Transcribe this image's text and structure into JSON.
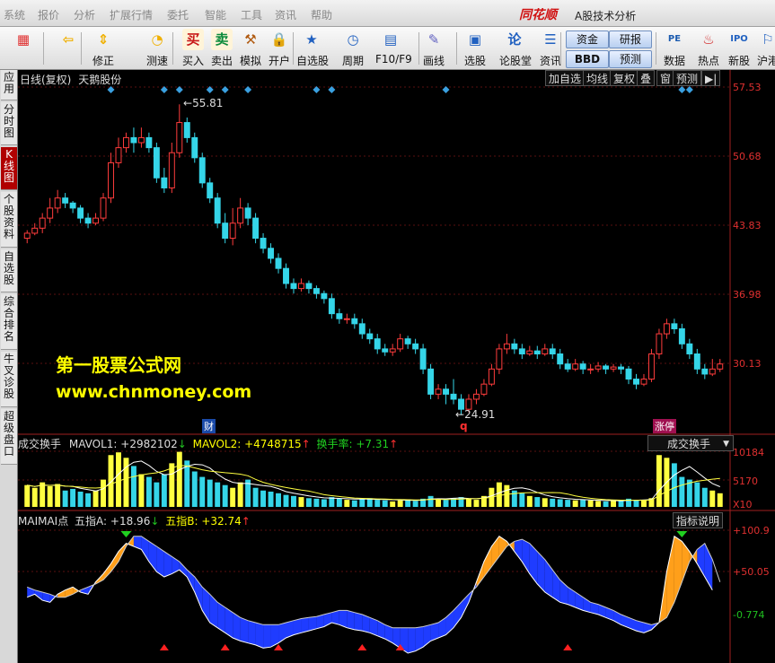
{
  "menu": [
    "系统",
    "报价",
    "分析",
    "扩展行情",
    "委托",
    "智能",
    "工具",
    "资讯",
    "帮助"
  ],
  "brand": "同花顺",
  "app_title": "A股技术分析",
  "toolbar": [
    {
      "label": "",
      "icon": "color-blocks-icon"
    },
    {
      "label": "",
      "icon": "back-arrow-icon"
    },
    {
      "label": "修正",
      "icon": "up-down-arrows-icon"
    },
    {
      "label": "测速",
      "icon": "speed-clock-icon"
    },
    {
      "label": "买入",
      "icon": "buy-icon",
      "glyph": "买"
    },
    {
      "label": "卖出",
      "icon": "sell-icon",
      "glyph": "卖"
    },
    {
      "label": "模拟",
      "icon": "hammer-icon"
    },
    {
      "label": "开户",
      "icon": "lock-icon"
    },
    {
      "label": "自选股",
      "icon": "star-list-icon"
    },
    {
      "label": "周期",
      "icon": "clock-cycle-icon"
    },
    {
      "label": "F10/F9",
      "icon": "f10-doc-icon"
    },
    {
      "label": "画线",
      "icon": "pencil-icon"
    },
    {
      "label": "选股",
      "icon": "stock-picker-icon"
    },
    {
      "label": "论股堂",
      "icon": "discussion-icon"
    },
    {
      "label": "资讯",
      "icon": "news-icon"
    },
    {
      "label": "资金",
      "icon": "funds-icon"
    },
    {
      "label": "BBD",
      "icon": "bbd-icon"
    },
    {
      "label": "研报",
      "icon": "research-icon"
    },
    {
      "label": "预测",
      "icon": "forecast-icon"
    },
    {
      "label": "数据",
      "icon": "pe-data-icon",
      "glyph": "PE"
    },
    {
      "label": "热点",
      "icon": "hot-spot-icon"
    },
    {
      "label": "新股",
      "icon": "ipo-icon",
      "glyph": "IPO"
    },
    {
      "label": "沪港",
      "icon": "hk-connect-icon"
    }
  ],
  "sidetabs": [
    {
      "label": "应用",
      "active": false
    },
    {
      "label": "分时图",
      "active": false
    },
    {
      "label": "K线图",
      "active": true
    },
    {
      "label": "个股资料",
      "active": false
    },
    {
      "label": "自选股",
      "active": false
    },
    {
      "label": "综合排名",
      "active": false
    },
    {
      "label": "牛叉诊股",
      "active": false
    },
    {
      "label": "超级盘口",
      "active": false
    }
  ],
  "chart_header": {
    "title": "日线(复权)",
    "stock": "天鹅股份",
    "buttons": [
      "加自选",
      "均线",
      "复权",
      "叠",
      "窗",
      "预测"
    ]
  },
  "price_axis": [
    "57.53",
    "50.68",
    "43.83",
    "36.98",
    "30.13"
  ],
  "annotations": {
    "high": "55.81",
    "low": "24.91",
    "marker_q": "q",
    "event_cai": "财",
    "event_zhang": "涨停"
  },
  "watermark": {
    "line1": "第一股票公式网",
    "line2": "www.chnmoney.com"
  },
  "volume_panel": {
    "name": "成交换手",
    "mavol1_label": "MAVOL1:",
    "mavol1_value": "+2982102",
    "mavol1_arrow": "↓",
    "mavol2_label": "MAVOL2:",
    "mavol2_value": "+4748715",
    "mavol2_arrow": "↑",
    "turnover_label": "换手率:",
    "turnover_value": "+7.31",
    "turnover_arrow": "↑",
    "selector": "成交换手",
    "axis": [
      "10184",
      "5170",
      "X10"
    ]
  },
  "indicator_panel": {
    "name": "MAIMAI点",
    "a_label": "五指A:",
    "a_value": "+18.96",
    "a_arrow": "↓",
    "b_label": "五指B:",
    "b_value": "+32.74",
    "b_arrow": "↑",
    "button": "指标说明",
    "axis": [
      "+100.9",
      "+50.05",
      "-0.774"
    ]
  },
  "chart_data": {
    "type": "candlestick",
    "series": [
      {
        "name": "price",
        "candles": [
          [
            42.5,
            43.0,
            42.0,
            43.3
          ],
          [
            43.0,
            43.5,
            42.8,
            44.0
          ],
          [
            43.5,
            44.5,
            43.0,
            45.0
          ],
          [
            44.5,
            45.5,
            44.0,
            46.5
          ],
          [
            45.5,
            46.5,
            45.0,
            47.3
          ],
          [
            46.5,
            46.0,
            45.5,
            47.0
          ],
          [
            46.0,
            45.5,
            45.0,
            46.2
          ],
          [
            45.5,
            44.5,
            44.0,
            45.8
          ],
          [
            44.5,
            44.0,
            43.5,
            45.0
          ],
          [
            44.0,
            44.5,
            43.8,
            45.0
          ],
          [
            44.5,
            46.5,
            44.2,
            47.0
          ],
          [
            46.5,
            50.0,
            46.0,
            51.0
          ],
          [
            50.0,
            51.5,
            49.5,
            52.5
          ],
          [
            51.5,
            52.5,
            51.0,
            53.0
          ],
          [
            52.5,
            52.0,
            51.0,
            53.5
          ],
          [
            52.0,
            52.5,
            51.5,
            53.5
          ],
          [
            52.5,
            51.5,
            51.0,
            53.0
          ],
          [
            51.5,
            48.5,
            48.0,
            52.0
          ],
          [
            48.5,
            47.5,
            47.0,
            49.5
          ],
          [
            47.5,
            51.0,
            47.0,
            52.0
          ],
          [
            51.0,
            54.0,
            50.5,
            55.81
          ],
          [
            54.0,
            52.5,
            52.0,
            54.5
          ],
          [
            52.5,
            50.5,
            50.0,
            53.0
          ],
          [
            50.5,
            48.0,
            47.5,
            51.0
          ],
          [
            48.0,
            46.5,
            46.0,
            48.5
          ],
          [
            46.5,
            44.0,
            43.5,
            47.0
          ],
          [
            44.0,
            42.5,
            42.0,
            45.0
          ],
          [
            42.5,
            44.0,
            41.8,
            45.5
          ],
          [
            44.0,
            45.5,
            43.5,
            46.5
          ],
          [
            45.5,
            44.5,
            43.8,
            46.0
          ],
          [
            44.5,
            42.5,
            42.0,
            45.0
          ],
          [
            42.5,
            41.5,
            41.0,
            43.0
          ],
          [
            41.5,
            40.5,
            40.0,
            42.0
          ],
          [
            40.5,
            39.5,
            39.0,
            41.0
          ],
          [
            39.5,
            38.0,
            37.5,
            40.0
          ],
          [
            38.0,
            37.5,
            37.0,
            38.5
          ],
          [
            37.5,
            38.0,
            37.2,
            38.5
          ],
          [
            38.0,
            37.5,
            37.0,
            38.3
          ],
          [
            37.5,
            37.0,
            36.5,
            37.8
          ],
          [
            37.0,
            36.5,
            36.0,
            37.3
          ],
          [
            36.5,
            35.0,
            34.5,
            37.0
          ],
          [
            35.0,
            34.5,
            34.0,
            35.5
          ],
          [
            34.5,
            34.5,
            34.0,
            35.0
          ],
          [
            34.5,
            34.0,
            33.5,
            35.0
          ],
          [
            34.0,
            33.0,
            32.5,
            34.5
          ],
          [
            33.0,
            32.5,
            32.0,
            33.5
          ],
          [
            32.5,
            31.5,
            31.0,
            33.0
          ],
          [
            31.5,
            31.2,
            30.8,
            32.0
          ],
          [
            31.2,
            31.5,
            30.8,
            32.0
          ],
          [
            31.5,
            32.5,
            31.2,
            33.0
          ],
          [
            32.5,
            32.0,
            31.5,
            32.8
          ],
          [
            32.0,
            31.5,
            31.0,
            32.5
          ],
          [
            31.5,
            29.5,
            29.0,
            32.0
          ],
          [
            29.5,
            27.0,
            26.5,
            30.0
          ],
          [
            27.0,
            27.5,
            26.5,
            28.0
          ],
          [
            27.5,
            27.0,
            26.0,
            28.0
          ],
          [
            27.0,
            26.5,
            26.0,
            28.5
          ],
          [
            26.5,
            25.5,
            24.91,
            27.0
          ],
          [
            25.5,
            26.5,
            25.2,
            27.0
          ],
          [
            26.5,
            27.0,
            26.0,
            27.5
          ],
          [
            27.0,
            28.0,
            26.8,
            28.5
          ],
          [
            28.0,
            29.5,
            27.8,
            30.0
          ],
          [
            29.5,
            31.5,
            29.0,
            32.0
          ],
          [
            31.5,
            32.0,
            31.0,
            33.0
          ],
          [
            32.0,
            31.5,
            31.0,
            32.5
          ],
          [
            31.5,
            31.0,
            30.5,
            32.0
          ],
          [
            31.0,
            31.3,
            30.8,
            31.8
          ],
          [
            31.3,
            31.0,
            30.5,
            31.8
          ],
          [
            31.0,
            31.5,
            30.8,
            32.0
          ],
          [
            31.5,
            31.0,
            30.5,
            32.0
          ],
          [
            31.0,
            30.0,
            29.5,
            31.5
          ],
          [
            30.0,
            29.5,
            29.2,
            30.5
          ],
          [
            29.5,
            30.0,
            29.3,
            30.5
          ],
          [
            30.0,
            29.5,
            29.0,
            30.3
          ],
          [
            29.5,
            29.5,
            29.0,
            30.0
          ],
          [
            29.5,
            29.8,
            29.2,
            30.2
          ],
          [
            29.8,
            29.5,
            29.0,
            30.0
          ],
          [
            29.5,
            29.7,
            29.2,
            30.0
          ],
          [
            29.7,
            29.5,
            29.0,
            30.0
          ],
          [
            29.5,
            28.5,
            28.0,
            29.8
          ],
          [
            28.5,
            28.0,
            27.5,
            29.0
          ],
          [
            28.0,
            28.5,
            27.8,
            29.0
          ],
          [
            28.5,
            31.0,
            28.2,
            31.5
          ],
          [
            31.0,
            33.0,
            30.5,
            33.5
          ],
          [
            33.0,
            34.0,
            32.5,
            34.5
          ],
          [
            34.0,
            33.5,
            33.0,
            34.5
          ],
          [
            33.5,
            32.0,
            31.5,
            34.0
          ],
          [
            32.0,
            31.0,
            30.5,
            32.5
          ],
          [
            31.0,
            29.5,
            29.0,
            31.5
          ],
          [
            29.5,
            29.0,
            28.5,
            30.0
          ],
          [
            29.0,
            29.5,
            28.8,
            30.5
          ],
          [
            29.5,
            30.0,
            29.2,
            30.5
          ]
        ]
      }
    ],
    "volume": [
      4.0,
      3.5,
      4.5,
      3.8,
      4.2,
      3.0,
      3.3,
      2.8,
      2.5,
      3.0,
      5.0,
      9.5,
      10.0,
      9.0,
      7.5,
      6.0,
      5.5,
      4.5,
      6.0,
      8.0,
      10.1,
      8.5,
      6.5,
      5.5,
      5.0,
      4.5,
      4.0,
      3.5,
      4.5,
      5.0,
      3.5,
      3.0,
      2.8,
      2.5,
      2.2,
      2.0,
      1.8,
      1.6,
      1.5,
      1.4,
      1.8,
      1.5,
      1.3,
      1.2,
      1.5,
      1.6,
      1.3,
      1.2,
      1.0,
      1.2,
      1.4,
      1.1,
      1.5,
      2.0,
      1.5,
      1.3,
      1.6,
      1.8,
      1.5,
      1.3,
      2.0,
      3.5,
      4.5,
      4.0,
      3.0,
      2.5,
      2.0,
      1.8,
      1.6,
      1.5,
      1.4,
      1.3,
      1.2,
      1.3,
      1.2,
      1.1,
      1.0,
      1.2,
      1.1,
      1.5,
      1.3,
      1.2,
      1.6,
      9.5,
      9.0,
      8.0,
      5.5,
      5.0,
      4.5,
      3.5,
      3.0,
      2.5
    ],
    "indicator_a": [
      35,
      38,
      32,
      30,
      38,
      42,
      45,
      40,
      38,
      50,
      58,
      68,
      80,
      88,
      85,
      82,
      70,
      60,
      55,
      58,
      62,
      55,
      40,
      22,
      10,
      5,
      0,
      -5,
      -8,
      -10,
      -12,
      -15,
      -14,
      -10,
      -5,
      -2,
      0,
      2,
      4,
      6,
      10,
      8,
      5,
      3,
      2,
      0,
      -3,
      -6,
      -10,
      -15,
      -20,
      -18,
      -14,
      -8,
      -5,
      -2,
      5,
      15,
      30,
      50,
      70,
      85,
      95,
      90,
      80,
      70,
      58,
      48,
      40,
      35,
      30,
      28,
      25,
      22,
      20,
      18,
      15,
      12,
      8,
      5,
      2,
      0,
      3,
      10,
      60,
      95,
      90,
      80,
      68,
      55,
      42
    ],
    "indicator_b": [
      45,
      42,
      40,
      38,
      35,
      35,
      38,
      42,
      45,
      48,
      52,
      60,
      70,
      85,
      95,
      95,
      90,
      85,
      80,
      75,
      70,
      62,
      55,
      45,
      38,
      30,
      25,
      20,
      15,
      12,
      10,
      8,
      8,
      8,
      10,
      12,
      14,
      15,
      16,
      18,
      20,
      22,
      22,
      20,
      18,
      15,
      12,
      8,
      5,
      5,
      5,
      5,
      6,
      8,
      10,
      15,
      22,
      30,
      38,
      45,
      55,
      65,
      75,
      85,
      90,
      92,
      88,
      80,
      72,
      62,
      52,
      45,
      40,
      35,
      30,
      28,
      25,
      22,
      18,
      15,
      12,
      10,
      8,
      10,
      15,
      30,
      50,
      70,
      82,
      88,
      72,
      50
    ]
  }
}
